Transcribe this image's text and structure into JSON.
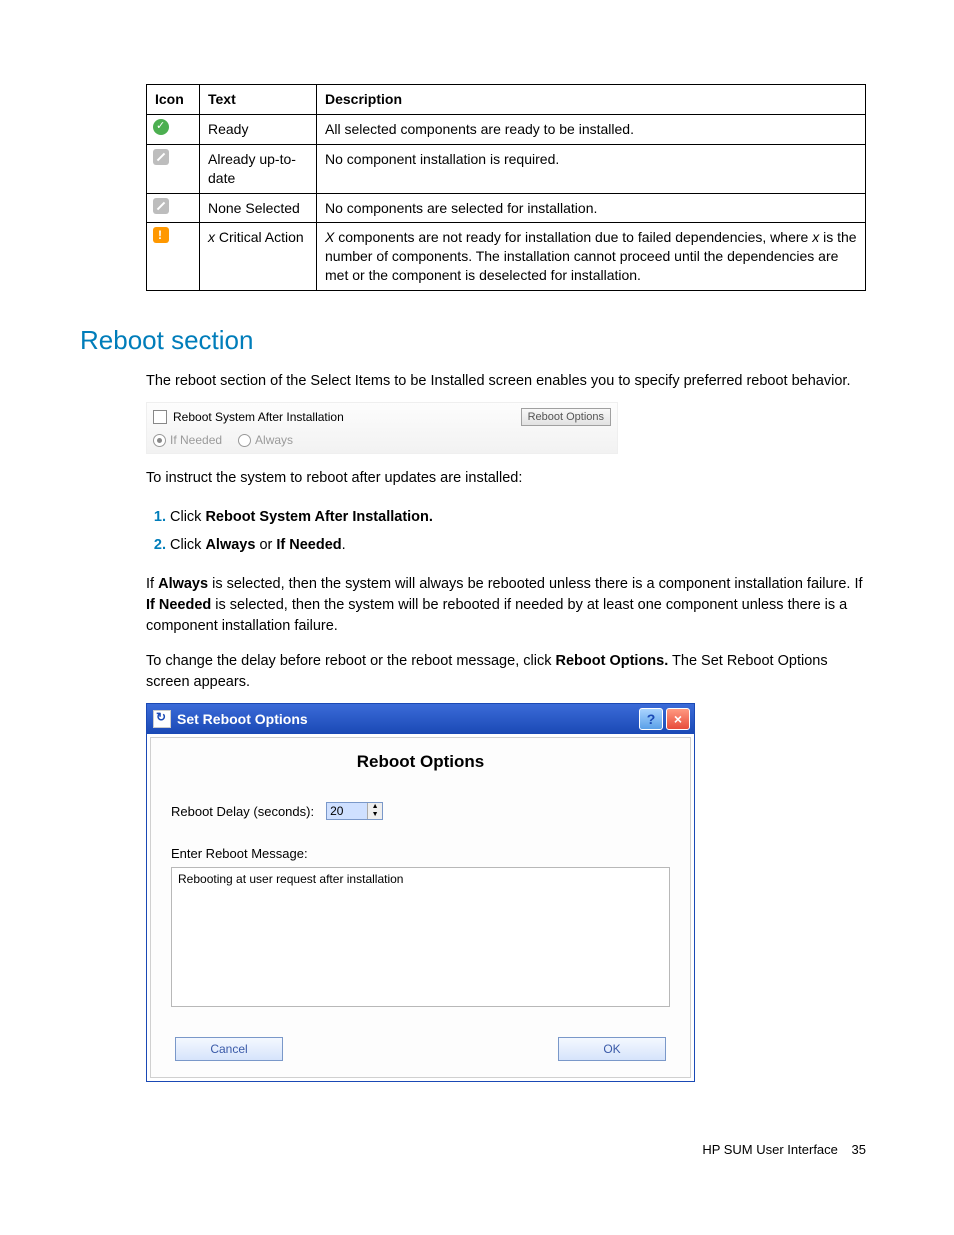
{
  "iconTable": {
    "headers": {
      "icon": "Icon",
      "text": "Text",
      "desc": "Description"
    },
    "rows": [
      {
        "text": "Ready",
        "desc": "All selected components are ready to be installed."
      },
      {
        "text": "Already up-to-date",
        "desc": "No component installation is required."
      },
      {
        "text": "None Selected",
        "desc": "No components are selected for installation."
      },
      {
        "text_prefix": "x",
        "text_rest": " Critical Action",
        "desc_prefix": "X",
        "desc_mid": " components are not ready for installation due to failed dependencies, where ",
        "desc_x": "x",
        "desc_rest": " is the number of components. The installation cannot proceed until the dependencies are met or the component is deselected for installation."
      }
    ]
  },
  "section": {
    "heading": "Reboot section",
    "intro": "The reboot section of the Select Items to be Installed screen enables you to specify preferred reboot behavior.",
    "strip": {
      "checkbox_label": "Reboot System After Installation",
      "button": "Reboot Options",
      "opt1": "If Needed",
      "opt2": "Always"
    },
    "instruct_lead": "To instruct the system to reboot after updates are installed:",
    "steps": [
      {
        "pre": "Click ",
        "b": "Reboot System After Installation."
      },
      {
        "pre": "Click ",
        "b1": "Always",
        "mid": " or ",
        "b2": "If Needed",
        "post": "."
      }
    ],
    "para_if": {
      "p1": "If ",
      "b1": "Always",
      "p2": " is selected, then the system will always be rebooted unless there is a component installation failure. If ",
      "b2": "If Needed",
      "p3": " is selected, then the system will be rebooted if needed by at least one component unless there is a component installation failure."
    },
    "para_change": {
      "p1": "To change the delay before reboot or the reboot message, click ",
      "b": "Reboot Options.",
      "p2": " The Set Reboot Options screen appears."
    }
  },
  "dialog": {
    "title": "Set Reboot Options",
    "heading": "Reboot Options",
    "delay_label": "Reboot Delay (seconds):",
    "delay_value": "20",
    "msg_label": "Enter Reboot Message:",
    "msg_value": "Rebooting at user request after installation",
    "cancel": "Cancel",
    "ok": "OK"
  },
  "footer": {
    "text": "HP SUM User Interface",
    "page": "35"
  }
}
